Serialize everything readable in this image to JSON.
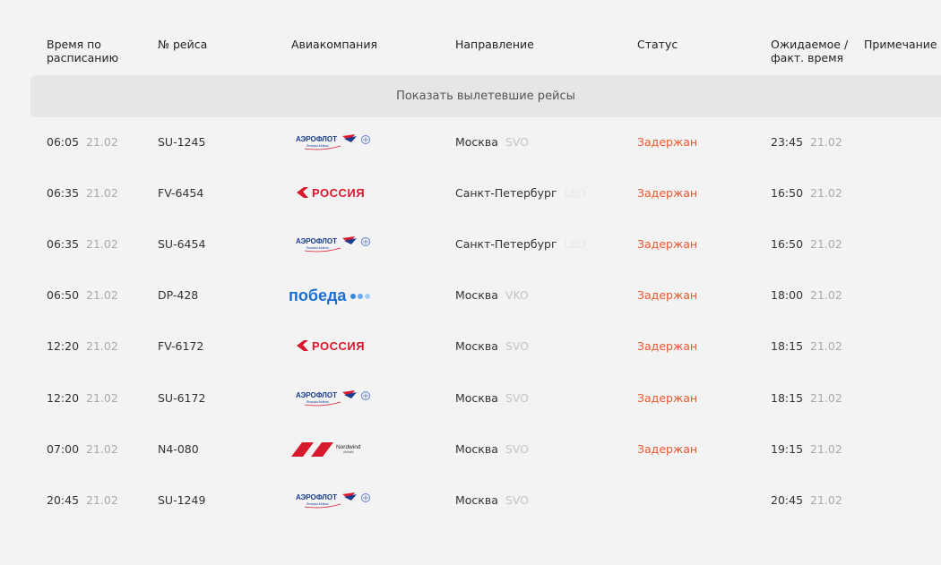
{
  "headers": {
    "sched": [
      "Время по",
      "расписанию"
    ],
    "flight": "№ рейса",
    "airline": "Авиакомпания",
    "dest": "Направление",
    "status": "Статус",
    "actual": [
      "Ожидаемое /",
      "факт. время"
    ],
    "note": "Примечание"
  },
  "show_departed": "Показать вылетевшие рейсы",
  "airline_logos": {
    "aeroflot": {
      "name": "АЭРОФЛОТ",
      "sub": "Russian Airlines"
    },
    "rossiya": {
      "name": "РОССИЯ"
    },
    "pobeda": {
      "name": "победа"
    },
    "nordwind": {
      "name": "Nordwind",
      "sub": "Airlines"
    }
  },
  "colors": {
    "status_delayed": "#e85a32",
    "aeroflot_blue": "#1a3d8f",
    "aeroflot_red": "#d7192d",
    "rossiya_red": "#d7192d",
    "pobeda_blue": "#1a6fd1",
    "nordwind_red": "#d7192d"
  },
  "flights": [
    {
      "time": "06:05",
      "date": "21.02",
      "flight": "SU-1245",
      "airline": "aeroflot",
      "city": "Москва",
      "code": "SVO",
      "status": "Задержан",
      "act_time": "23:45",
      "act_date": "21.02"
    },
    {
      "time": "06:35",
      "date": "21.02",
      "flight": "FV-6454",
      "airline": "rossiya",
      "city": "Санкт-Петербург",
      "code": "LED",
      "status": "Задержан",
      "act_time": "16:50",
      "act_date": "21.02"
    },
    {
      "time": "06:35",
      "date": "21.02",
      "flight": "SU-6454",
      "airline": "aeroflot",
      "city": "Санкт-Петербург",
      "code": "LED",
      "status": "Задержан",
      "act_time": "16:50",
      "act_date": "21.02"
    },
    {
      "time": "06:50",
      "date": "21.02",
      "flight": "DP-428",
      "airline": "pobeda",
      "city": "Москва",
      "code": "VKO",
      "status": "Задержан",
      "act_time": "18:00",
      "act_date": "21.02"
    },
    {
      "time": "12:20",
      "date": "21.02",
      "flight": "FV-6172",
      "airline": "rossiya",
      "city": "Москва",
      "code": "SVO",
      "status": "Задержан",
      "act_time": "18:15",
      "act_date": "21.02"
    },
    {
      "time": "12:20",
      "date": "21.02",
      "flight": "SU-6172",
      "airline": "aeroflot",
      "city": "Москва",
      "code": "SVO",
      "status": "Задержан",
      "act_time": "18:15",
      "act_date": "21.02"
    },
    {
      "time": "07:00",
      "date": "21.02",
      "flight": "N4-080",
      "airline": "nordwind",
      "city": "Москва",
      "code": "SVO",
      "status": "Задержан",
      "act_time": "19:15",
      "act_date": "21.02"
    },
    {
      "time": "20:45",
      "date": "21.02",
      "flight": "SU-1249",
      "airline": "aeroflot",
      "city": "Москва",
      "code": "SVO",
      "status": "",
      "act_time": "20:45",
      "act_date": "21.02"
    }
  ]
}
